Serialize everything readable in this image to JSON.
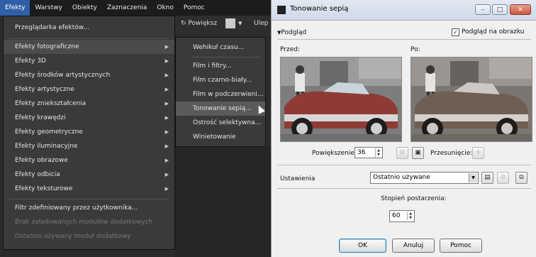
{
  "menubar": {
    "items": [
      "Efekty",
      "Warstwy",
      "Obiekty",
      "Zaznaczenia",
      "Okno",
      "Pomoc"
    ]
  },
  "effects_menu": {
    "items": [
      "Przeglądarka efektów...",
      "Efekty fotograficzne",
      "Efekty 3D",
      "Efekty środków artystycznych",
      "Efekty artystyczne",
      "Efekty zniekształcenia",
      "Efekty krawędzi",
      "Efekty geometryczne",
      "Efekty iluminacyjne",
      "Efekty obrazowe",
      "Efekty odbicia",
      "Efekty teksturowe",
      "Filtr zdefiniowany przez użytkownika...",
      "Brak załadowanych modułów dodatkowych",
      "Ostatnio używany moduł dodatkowy"
    ]
  },
  "toolbar": {
    "zoom_label": "Powiększ",
    "partial_label": "Ulep"
  },
  "photo_submenu": {
    "items": [
      "Wehikuł czasu...",
      "Film i filtry...",
      "Film czarno-biały...",
      "Film w podczerwieni...",
      "Tonowanie sepią...",
      "Ostrość selektywna...",
      "Winietowanie"
    ]
  },
  "dialog": {
    "title": "Tonowanie sepią",
    "preview_toggle": "Podgląd",
    "preview_on_image": "Podgląd na obrazku",
    "before_label": "Przed:",
    "after_label": "Po:",
    "zoom_label": "Powiększenie:",
    "zoom_value": "36",
    "pan_label": "Przesunięcie:",
    "settings_label": "Ustawienia",
    "settings_value": "Ostatnio używane",
    "aging_label": "Stopień postarzenia:",
    "aging_value": "60",
    "ok_label": "OK",
    "cancel_label": "Anuluj",
    "help_label": "Pomoc"
  }
}
